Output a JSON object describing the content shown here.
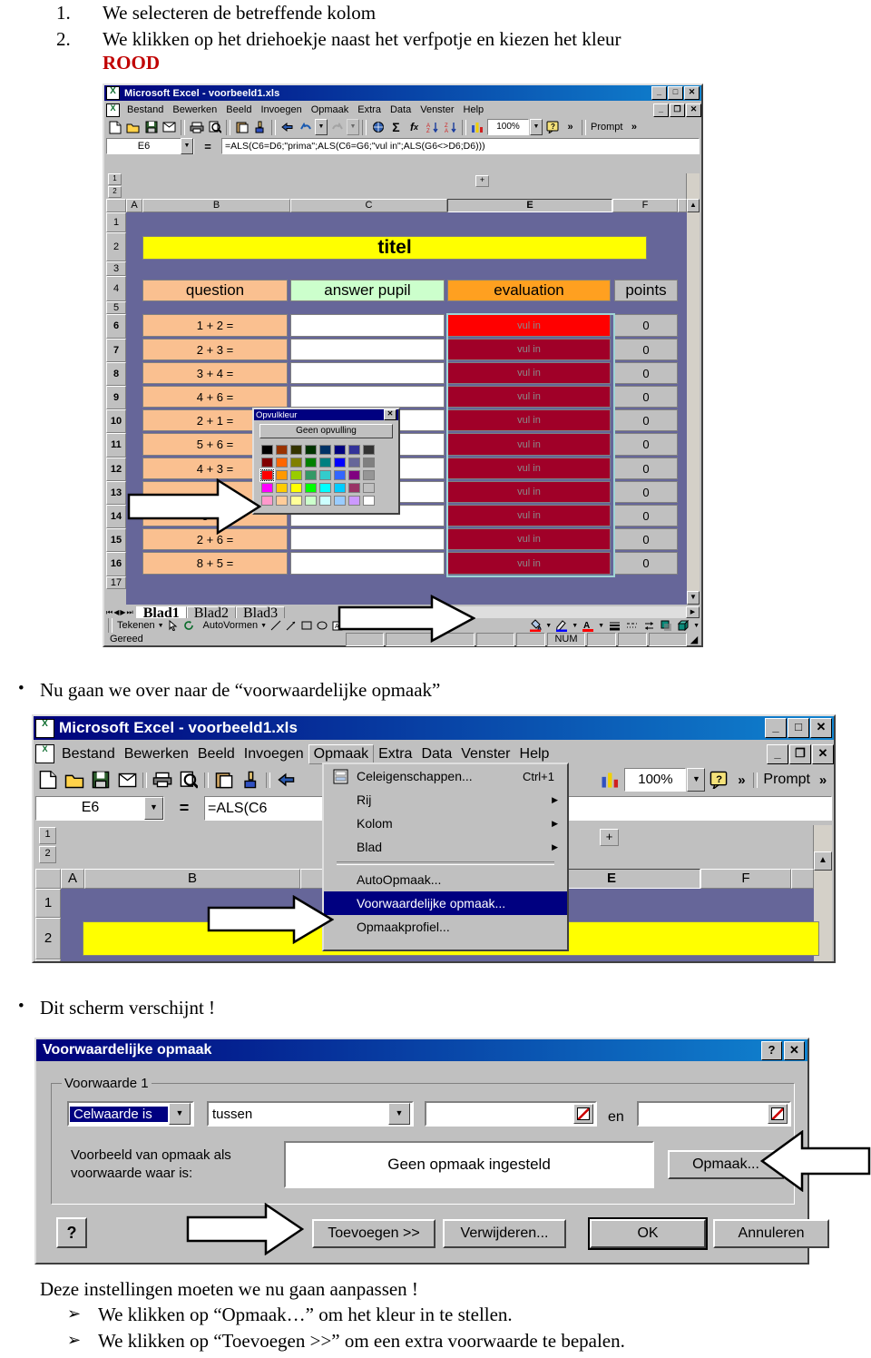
{
  "doc": {
    "step1_num": "1.",
    "step1_text": "We selecteren de betreffende kolom",
    "step2_num": "2.",
    "step2_text": "We klikken op het driehoekje naast het verfpotje en kiezen het kleur",
    "step2_color_word": "ROOD",
    "mid_text_1": "Nu gaan we over naar de “voorwaardelijke opmaak”",
    "mid_text_2": "Dit scherm verschijnt !",
    "footer_lead": "Deze instellingen moeten we nu gaan aanpassen !",
    "footer_b1": "We klikken op “Opmaak…” om het kleur in te stellen.",
    "footer_b2": "We klikken op “Toevoegen >>” om een extra voorwaarde te bepalen.",
    "bullet_glyph": "•",
    "arrow_glyph": "➢"
  },
  "excel": {
    "title": "Microsoft Excel - voorbeeld1.xls",
    "menu": [
      "Bestand",
      "Bewerken",
      "Beeld",
      "Invoegen",
      "Opmaak",
      "Extra",
      "Data",
      "Venster",
      "Help"
    ],
    "sys_min": "_",
    "sys_max": "□",
    "sys_close": "✕",
    "doc_min": "_",
    "doc_restore": "❐",
    "doc_close": "✕",
    "zoom": "100%",
    "prompt_label": "Prompt",
    "chevron": "»",
    "namebox_value": "E6",
    "equals_sign": "=",
    "formula_full": "=ALS(C6=D6;\"prima\";ALS(C6=G6;\"vul in\";ALS(G6<>D6;D6)))",
    "formula_left_clipped": "=ALS(C6",
    "formula_right_clipped": "ALS(G6<>D6;D6)))",
    "outline_levels": [
      "1",
      "2"
    ],
    "column_headers": [
      "A",
      "B",
      "C",
      "E",
      "F"
    ],
    "selected_column": "E",
    "row_headers": [
      "1",
      "2",
      "3",
      "4",
      "5",
      "6",
      "7",
      "8",
      "9",
      "10",
      "11",
      "12",
      "13",
      "14",
      "15",
      "16",
      "17"
    ],
    "title_cell": "titel",
    "headers": {
      "question": "question",
      "answer": "answer pupil",
      "evaluation": "evaluation",
      "points": "points"
    },
    "rows": [
      {
        "row": "6",
        "question": "1 + 2 =",
        "answer": "",
        "evaluation": "vul in",
        "points": "0",
        "eval_color": "#ff0000"
      },
      {
        "row": "7",
        "question": "2 + 3 =",
        "answer": "",
        "evaluation": "vul in",
        "points": "0",
        "eval_color": "#a00028"
      },
      {
        "row": "8",
        "question": "3 + 4 =",
        "answer": "",
        "evaluation": "vul in",
        "points": "0",
        "eval_color": "#a00028"
      },
      {
        "row": "9",
        "question": "4 + 6 =",
        "answer": "",
        "evaluation": "vul in",
        "points": "0",
        "eval_color": "#a00028"
      },
      {
        "row": "10",
        "question": "2 + 1 =",
        "answer": "",
        "evaluation": "vul in",
        "points": "0",
        "eval_color": "#a00028"
      },
      {
        "row": "11",
        "question": "5 + 6 =",
        "answer": "",
        "evaluation": "vul in",
        "points": "0",
        "eval_color": "#a00028"
      },
      {
        "row": "12",
        "question": "4 + 3 =",
        "answer": "",
        "evaluation": "vul in",
        "points": "0",
        "eval_color": "#a00028"
      },
      {
        "row": "13",
        "question": "",
        "answer": "",
        "evaluation": "vul in",
        "points": "0",
        "eval_color": "#a00028"
      },
      {
        "row": "14",
        "question": "3 + 3",
        "answer": "",
        "evaluation": "vul in",
        "points": "0",
        "eval_color": "#a00028"
      },
      {
        "row": "15",
        "question": "2 + 6 =",
        "answer": "",
        "evaluation": "vul in",
        "points": "0",
        "eval_color": "#a00028"
      },
      {
        "row": "16",
        "question": "8 + 5 =",
        "answer": "",
        "evaluation": "vul in",
        "points": "0",
        "eval_color": "#a00028"
      }
    ],
    "sheet_tabs": [
      "Blad1",
      "Blad2",
      "Blad3"
    ],
    "active_sheet": "Blad1",
    "drawbar": {
      "tekenen": "Tekenen",
      "autovormen": "AutoVormen"
    },
    "status": "Gereed",
    "num_lock": "NUM",
    "colors": {
      "title_fill": "#ffff00",
      "question_fill": "#fac090",
      "answer_fill": "#ccffcc",
      "evaluation_fill": "#ffa020",
      "points_fill": "#c0c0c0",
      "sheet_bg": "#666699"
    }
  },
  "fillpicker": {
    "title": "Opvulkleur",
    "close": "✕",
    "no_fill_label": "Geen opvulling",
    "selected_index": 16,
    "swatches": [
      "#000000",
      "#993300",
      "#333300",
      "#003300",
      "#003366",
      "#000080",
      "#333399",
      "#333333",
      "#800000",
      "#ff6600",
      "#808000",
      "#008000",
      "#008080",
      "#0000ff",
      "#666699",
      "#808080",
      "#ff0000",
      "#ff9900",
      "#99cc00",
      "#339966",
      "#33cccc",
      "#3366ff",
      "#800080",
      "#969696",
      "#ff00ff",
      "#ffcc00",
      "#ffff00",
      "#00ff00",
      "#00ffff",
      "#00ccff",
      "#993366",
      "#c0c0c0",
      "#ff99cc",
      "#ffcc99",
      "#ffff99",
      "#ccffcc",
      "#ccffff",
      "#99ccff",
      "#cc99ff",
      "#ffffff"
    ]
  },
  "opmaakmenu": {
    "items": [
      {
        "label": "Celeigenschappen...",
        "accel": "Ctrl+1",
        "submenu": false,
        "icon": "cell-properties-icon",
        "highlight": false
      },
      {
        "label": "Rij",
        "accel": "",
        "submenu": true,
        "icon": "",
        "highlight": false
      },
      {
        "label": "Kolom",
        "accel": "",
        "submenu": true,
        "icon": "",
        "highlight": false
      },
      {
        "label": "Blad",
        "accel": "",
        "submenu": true,
        "icon": "",
        "highlight": false
      },
      {
        "label": "AutoOpmaak...",
        "accel": "",
        "submenu": false,
        "icon": "",
        "highlight": false
      },
      {
        "label": "Voorwaardelijke opmaak...",
        "accel": "",
        "submenu": false,
        "icon": "",
        "highlight": true
      },
      {
        "label": "Opmaakprofiel...",
        "accel": "",
        "submenu": false,
        "icon": "",
        "highlight": false
      }
    ],
    "submenu_arrow": "▶"
  },
  "cfdialog": {
    "title": "Voorwaardelijke opmaak",
    "help_btn": "?",
    "close_btn": "✕",
    "group_label": "Voorwaarde 1",
    "condition_type": "Celwaarde is",
    "operator": "tussen",
    "value1": "",
    "value2": "",
    "between_label": "en",
    "preview_label_line1": "Voorbeeld van opmaak als",
    "preview_label_line2": "voorwaarde waar is:",
    "preview_text": "Geen opmaak ingesteld",
    "format_button": "Opmaak...",
    "help_button": "?",
    "add_button": "Toevoegen >>",
    "delete_button": "Verwijderen...",
    "ok_button": "OK",
    "cancel_button": "Annuleren",
    "dropdown_arrow": "▼"
  }
}
